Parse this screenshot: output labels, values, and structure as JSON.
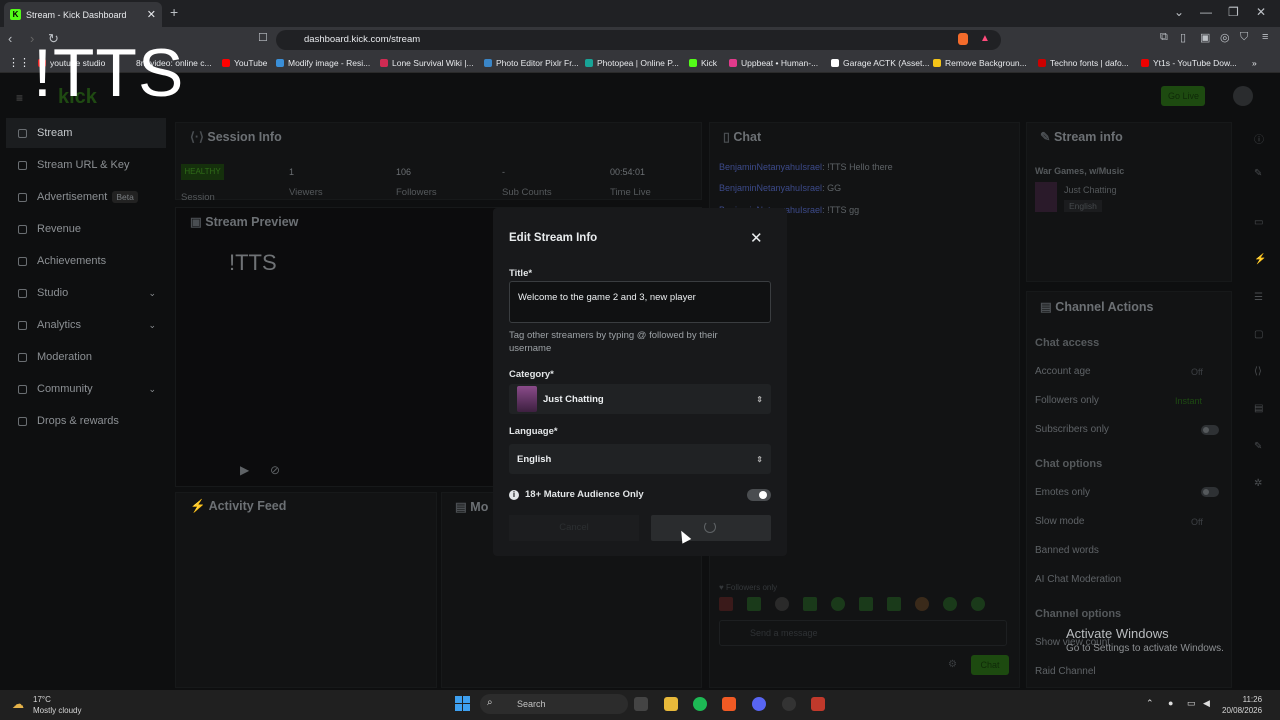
{
  "browser": {
    "tab_title": "Stream - Kick Dashboard",
    "url": "dashboard.kick.com/stream",
    "bookmarks": [
      "youtube studio",
      "8m video: online c...",
      "YouTube",
      "Modify image - Resi...",
      "Lone Survival Wiki |...",
      "Photo Editor Pixlr Fr...",
      "Photopea | Online P...",
      "Kick",
      "Uppbeat • Human-...",
      "Garage ACTK (Asset...",
      "Remove Backgroun...",
      "Techno fonts | dafo...",
      "Yt1s - YouTube Dow..."
    ]
  },
  "overlay_text": "!TTS",
  "header": {
    "go_live": "Go Live"
  },
  "sidebar": {
    "items": [
      {
        "label": "Stream"
      },
      {
        "label": "Stream URL & Key"
      },
      {
        "label": "Advertisement",
        "badge": "Beta"
      },
      {
        "label": "Revenue"
      },
      {
        "label": "Achievements"
      },
      {
        "label": "Studio"
      },
      {
        "label": "Analytics"
      },
      {
        "label": "Moderation"
      },
      {
        "label": "Community"
      },
      {
        "label": "Drops & rewards"
      }
    ]
  },
  "session": {
    "title": "Session Info",
    "status": "HEALTHY",
    "viewers": "1",
    "followers": "106",
    "subs": "-",
    "time": "00:54:01",
    "labels": {
      "session": "Session",
      "viewers": "Viewers",
      "followers": "Followers",
      "subs": "Sub Counts",
      "time": "Time Live"
    }
  },
  "preview": {
    "title": "Stream Preview",
    "overlay": "!TTS"
  },
  "activity": {
    "title": "Activity Feed"
  },
  "mod": {
    "title": "Mo"
  },
  "chat": {
    "title": "Chat",
    "lines": [
      {
        "user": "BenjaminNetanyahuIsrael",
        "text": ": !TTS Hello there"
      },
      {
        "user": "BenjaminNetanyahuIsrael",
        "text": ": GG"
      },
      {
        "user": "BenjaminNetanyahuIsrael",
        "text": ": !TTS gg"
      }
    ],
    "mode": "Followers only",
    "placeholder": "Send a message",
    "send": "Chat"
  },
  "stream_info": {
    "title": "Stream info",
    "stream_title": "War Games, w/Music",
    "category": "Just Chatting",
    "language": "English"
  },
  "channel_actions": {
    "title": "Channel Actions",
    "chat_access": "Chat access",
    "account_age": "Account age",
    "account_age_val": "Off",
    "followers_only": "Followers only",
    "followers_only_val": "Instant",
    "subscribers_only": "Subscribers only",
    "chat_options": "Chat options",
    "emotes_only": "Emotes only",
    "slow_mode": "Slow mode",
    "slow_mode_val": "Off",
    "banned_words": "Banned words",
    "ai_mod": "AI Chat Moderation",
    "channel_options": "Channel options",
    "show_view_count": "Show view count",
    "raid": "Raid Channel"
  },
  "modal": {
    "title": "Edit Stream Info",
    "title_label": "Title*",
    "title_value": "Welcome to the game 2 and 3, new player",
    "hint": "Tag other streamers by typing @ followed by their username",
    "category_label": "Category*",
    "category_value": "Just Chatting",
    "language_label": "Language*",
    "language_value": "English",
    "mature_label": "18+ Mature Audience Only",
    "cancel": "Cancel"
  },
  "windows": {
    "activate_title": "Activate Windows",
    "activate_sub": "Go to Settings to activate Windows."
  },
  "taskbar": {
    "temp": "17°C",
    "weather": "Mostly cloudy",
    "search": "Search",
    "time": "11:26",
    "date": "20/08/2026"
  }
}
